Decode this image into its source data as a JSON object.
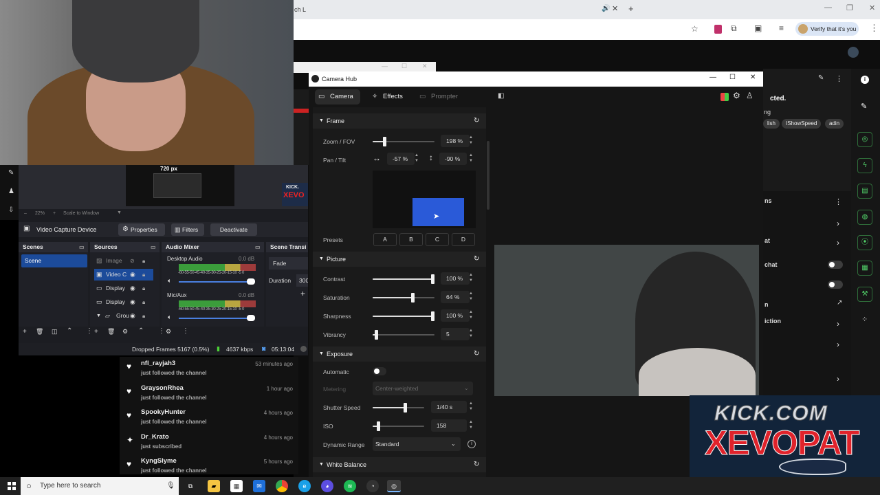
{
  "browser": {
    "tab_fragment": "ch L",
    "verify_label": "Verify that it's you"
  },
  "camera_hub": {
    "title": "Camera Hub",
    "tabs": [
      "Camera",
      "Effects",
      "Prompter"
    ],
    "frame": {
      "title": "Frame",
      "zoom_label": "Zoom / FOV",
      "zoom_value": "198 %",
      "zoom_level": 0.19,
      "pan_tilt_label": "Pan / Tilt",
      "pan_value": "-57 %",
      "tilt_value": "-90 %",
      "presets_label": "Presets",
      "presets": [
        "A",
        "B",
        "C",
        "D"
      ]
    },
    "picture": {
      "title": "Picture",
      "rows": [
        {
          "label": "Contrast",
          "value": "100 %",
          "level": 1.0
        },
        {
          "label": "Saturation",
          "value": "64 %",
          "level": 0.64
        },
        {
          "label": "Sharpness",
          "value": "100 %",
          "level": 1.0
        },
        {
          "label": "Vibrancy",
          "value": "5",
          "level": 0.05
        }
      ]
    },
    "exposure": {
      "title": "Exposure",
      "automatic_label": "Automatic",
      "metering_label": "Metering",
      "metering_value": "Center-weighted",
      "shutter_label": "Shutter Speed",
      "shutter_value": "1/40 s",
      "shutter_level": 0.63,
      "iso_label": "ISO",
      "iso_value": "158",
      "iso_level": 0.1,
      "dynamic_label": "Dynamic Range",
      "dynamic_value": "Standard"
    },
    "white_balance": {
      "title": "White Balance"
    }
  },
  "obs": {
    "preview_label": "720 px",
    "zoom_label": "22%",
    "scale_label": "Scale to Window",
    "source_name": "Video Capture Device",
    "properties_label": "Properties",
    "filters_label": "Filters",
    "deactivate_label": "Deactivate",
    "scenes_title": "Scenes",
    "scene_item": "Scene",
    "sources_title": "Sources",
    "sources": [
      "Image",
      "Video C",
      "Display",
      "Display",
      "Grou"
    ],
    "mixer_title": "Audio Mixer",
    "mixer": [
      {
        "name": "Desktop Audio",
        "db": "0.0 dB"
      },
      {
        "name": "Mic/Aux",
        "db": "0.0 dB"
      }
    ],
    "meter_scale": "-60-55-50-45-40-35-30-25-20-15-10 -5 0",
    "transitions_title": "Scene Transi",
    "transition_value": "Fade",
    "duration_label": "Duration",
    "duration_value": "300",
    "status": {
      "dropped": "Dropped Frames 5167 (0.5%)",
      "kbps": "4637 kbps",
      "time": "05:13:04"
    }
  },
  "feed": [
    {
      "name": "nfl_rayjah3",
      "sub": "just followed the channel",
      "time": "53 minutes ago",
      "icon": "heart-icon"
    },
    {
      "name": "GraysonRhea",
      "sub": "just followed the channel",
      "time": "1 hour ago",
      "icon": "heart-icon"
    },
    {
      "name": "SpookyHunter",
      "sub": "just followed the channel",
      "time": "4 hours ago",
      "icon": "heart-icon"
    },
    {
      "name": "Dr_Krato",
      "sub": "just subscribed",
      "time": "4 hours ago",
      "icon": "star-icon"
    },
    {
      "name": "KyngSlyme",
      "sub": "just followed the channel",
      "time": "5 hours ago",
      "icon": "heart-icon"
    }
  ],
  "right_panel": {
    "cut_title": "cted.",
    "cut_ng": "ng",
    "chips": [
      "lish",
      "IShowSpeed",
      "adin"
    ],
    "label_ns": "ns",
    "label_at": "at",
    "label_chat": "chat",
    "label_n": "n",
    "label_iction": "iction"
  },
  "kick": {
    "line1": "KICK.COM",
    "line2": "XEVOPAT"
  },
  "taskbar": {
    "search_placeholder": "Type here to search"
  },
  "colors": {
    "accent_blue": "#2a5ad8",
    "active_scene": "#1c4b9a",
    "kick_green": "#53fc18"
  }
}
